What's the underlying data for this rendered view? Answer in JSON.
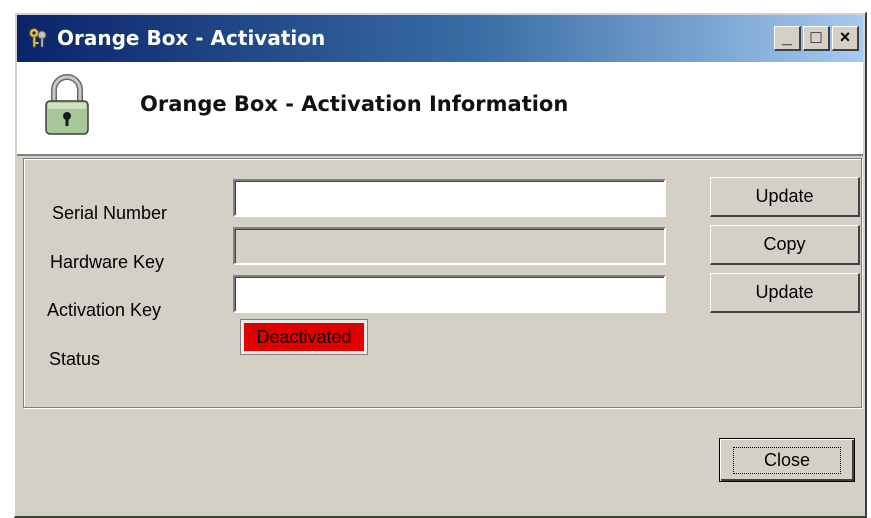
{
  "window": {
    "title": "Orange Box - Activation",
    "controls": {
      "minimize": "_",
      "maximize": "□",
      "close": "×"
    }
  },
  "header": {
    "title": "Orange Box - Activation Information",
    "icon": "padlock-icon"
  },
  "form": {
    "serial_label": "Serial Number",
    "serial_value": "",
    "hardware_label": "Hardware Key",
    "hardware_value": "",
    "activation_label": "Activation Key",
    "activation_value": "",
    "status_label": "Status",
    "status_value": "Deactivated",
    "status_color": "#e00000"
  },
  "buttons": {
    "update_serial": "Update",
    "copy": "Copy",
    "update_activation": "Update",
    "close": "Close"
  }
}
